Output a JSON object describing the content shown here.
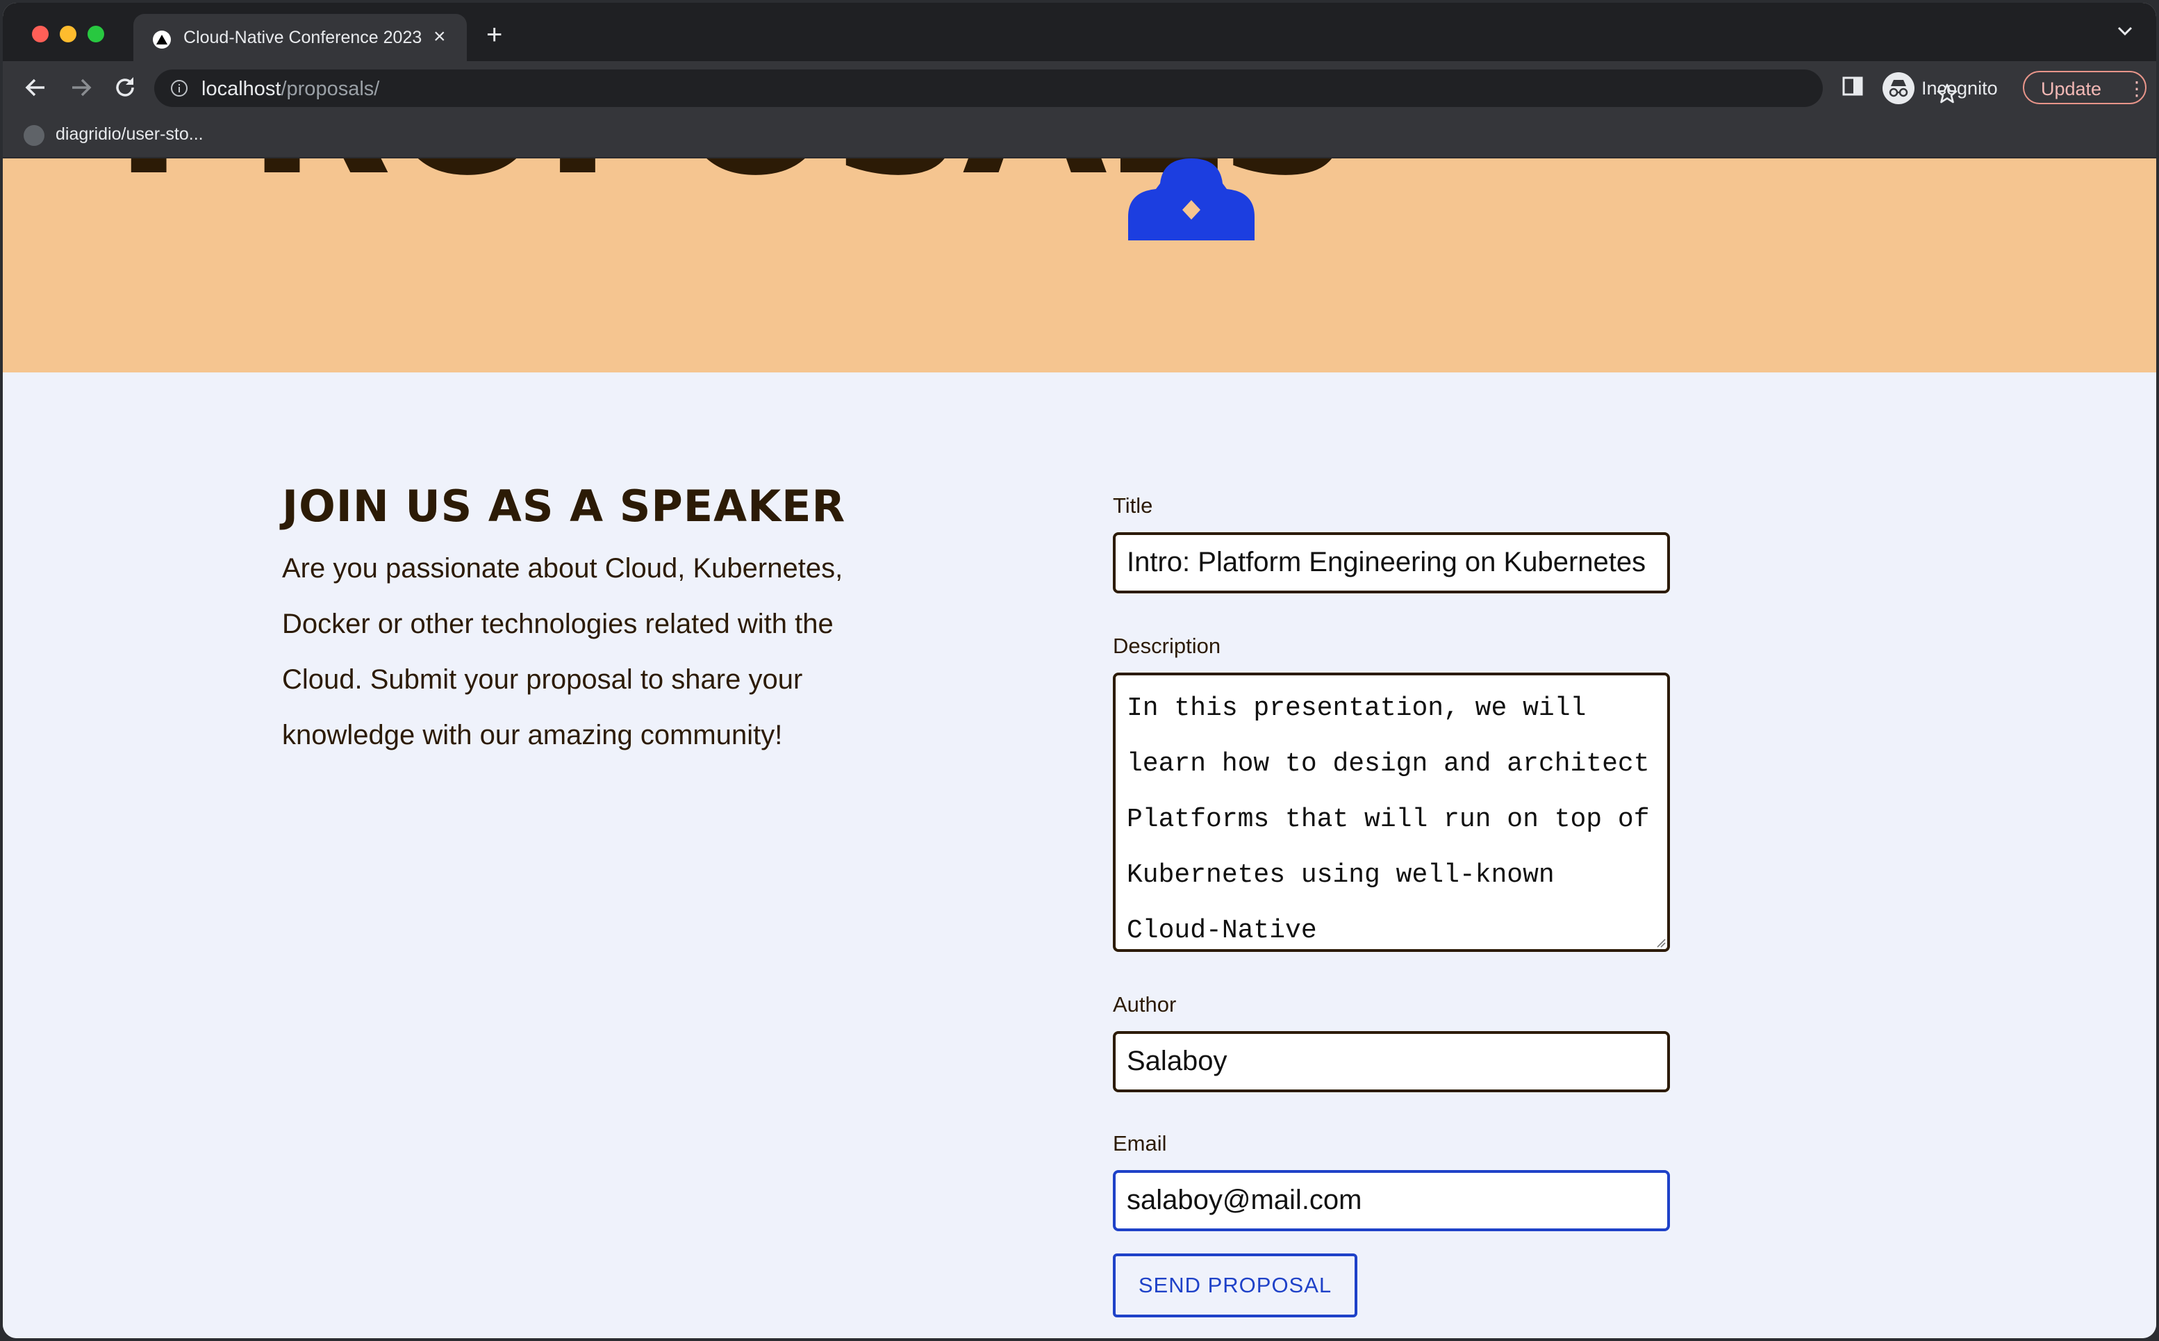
{
  "browser": {
    "tab_title": "Cloud-Native Conference 2023",
    "url_host": "localhost",
    "url_path": "/proposals/",
    "profile_label": "Incognito",
    "update_label": "Update",
    "bookmark_label": "diagridio/user-sto...",
    "traffic_light_colors": [
      "#ff5f57",
      "#febc2e",
      "#28c840"
    ]
  },
  "hero": {
    "title": "PROPOSALS",
    "background_color": "#f5c590",
    "logo_color": "#1c3ee0"
  },
  "intro": {
    "heading": "JOIN US AS A SPEAKER",
    "body": "Are you passionate about Cloud, Kubernetes, Docker or other technologies related with the Cloud. Submit your proposal to share your knowledge with our amazing community!"
  },
  "form": {
    "title_label": "Title",
    "title_value": "Intro: Platform Engineering on Kubernetes",
    "description_label": "Description",
    "description_value": "In this presentation, we will learn how to design and architect Platforms that will run on top of Kubernetes using well-known Cloud-Native",
    "author_label": "Author",
    "author_value": "Salaboy",
    "email_label": "Email",
    "email_value": "salaboy@mail.com",
    "submit_label": "SEND PROPOSAL",
    "accent_color": "#1f42c8"
  }
}
